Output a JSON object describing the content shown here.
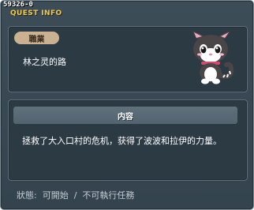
{
  "window": {
    "quest_id": "59326-0",
    "title": "QUEST INFO"
  },
  "quest": {
    "job_label": "職業",
    "name": "林之灵的路",
    "portrait_icon": "cat-npc-icon"
  },
  "content": {
    "header": "内容",
    "text": "拯救了大入口村的危机，获得了波波和拉伊的力量。"
  },
  "status": {
    "text": "狀態:  可開始  /  不可執行任務"
  },
  "colors": {
    "title": "#f2c94c",
    "job_pill": "#cab191",
    "panel_bg": "#2c3a44",
    "window_bg": "#3d4d58"
  }
}
